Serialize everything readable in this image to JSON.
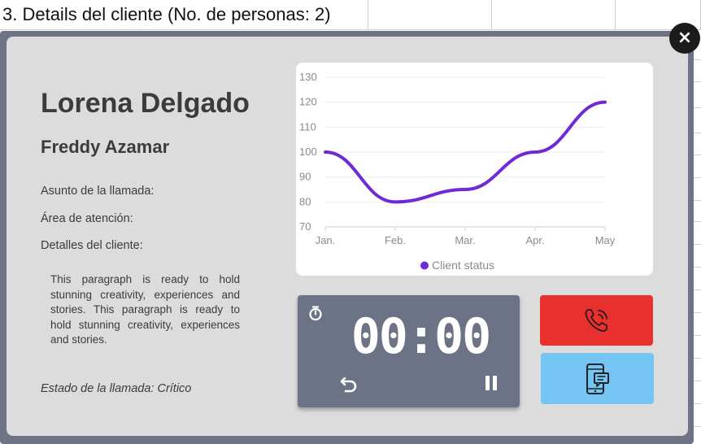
{
  "sheet": {
    "title": "3. Details del cliente (No. de personas: 2)"
  },
  "modal": {
    "close_label": "×",
    "client_name": "Lorena Delgado",
    "contact_name": "Freddy Azamar",
    "fields": {
      "call_subject_label": "Asunto de la llamada:",
      "attention_area_label": "Área de atención:",
      "client_details_label": "Detalles del cliente:"
    },
    "details_paragraph": "This paragraph is ready to hold stunning creativity, experiences and stories. This paragraph is ready to hold stunning creativity, experiences and stories.",
    "call_status": "Estado de la llamada: Crítico",
    "timer": {
      "display": "00:00",
      "icons": {
        "timer": "stopwatch-icon",
        "reset": "undo-icon",
        "pause": "pause-icon"
      }
    },
    "actions": {
      "call_icon": "phone-call-icon",
      "message_icon": "mobile-message-icon"
    }
  },
  "colors": {
    "accent_line": "#6f2ad6",
    "call_button": "#e8302f",
    "message_button": "#74c5f3",
    "timer_background": "#6d7386",
    "modal_background": "#dcdcdc"
  },
  "chart_data": {
    "type": "line",
    "categories": [
      "Jan.",
      "Feb.",
      "Mar.",
      "Apr.",
      "May"
    ],
    "series": [
      {
        "name": "Client status",
        "values": [
          100,
          80,
          85,
          100,
          120
        ]
      }
    ],
    "ylim": [
      70,
      130
    ],
    "yticks": [
      70,
      80,
      90,
      100,
      110,
      120,
      130
    ],
    "grid": true,
    "legend": "bottom"
  }
}
